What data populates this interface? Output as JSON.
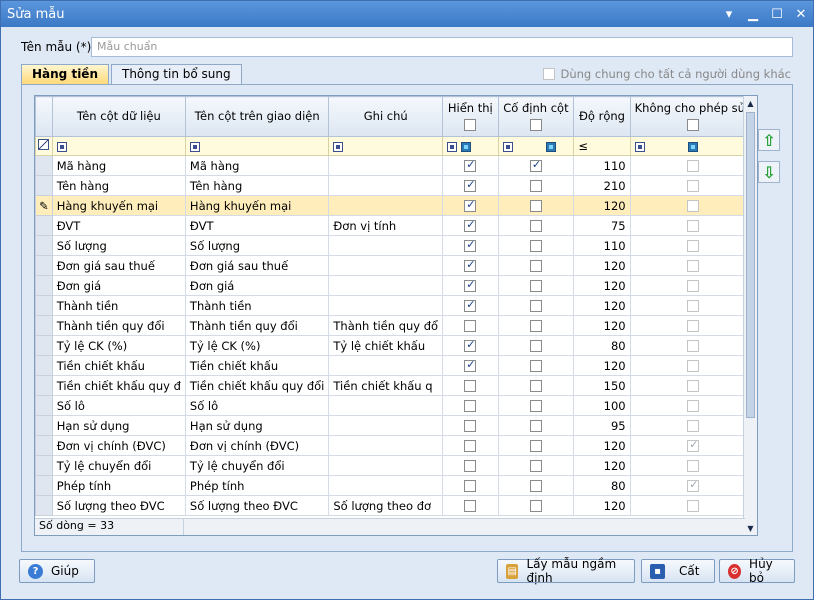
{
  "window": {
    "title": "Sửa mẫu"
  },
  "form": {
    "name_label": "Tên mẫu (*)",
    "name_value": "Mẫu chuẩn"
  },
  "tabs": [
    {
      "label": "Hàng tiền"
    },
    {
      "label": "Thông tin bổ sung"
    }
  ],
  "share_label": "Dùng chung cho tất cả người dùng khác",
  "grid": {
    "headers": {
      "data_col": "Tên cột dữ liệu",
      "ui_col": "Tên cột trên giao diện",
      "note": "Ghi chú",
      "show": "Hiển thị",
      "fixed": "Cố định cột",
      "width": "Độ rộng",
      "no_edit": "Không cho phép sửa"
    },
    "width_filter_op": "≤",
    "rows": [
      {
        "data": "Mã hàng",
        "ui": "Mã hàng",
        "note": "",
        "show": true,
        "fixed": true,
        "width": "110",
        "no_edit": false
      },
      {
        "data": "Tên hàng",
        "ui": "Tên hàng",
        "note": "",
        "show": true,
        "fixed": false,
        "width": "210",
        "no_edit": false
      },
      {
        "data": "Hàng khuyến mại",
        "ui": "Hàng khuyến mại",
        "note": "",
        "show": true,
        "fixed": false,
        "width": "120",
        "no_edit": false
      },
      {
        "data": "ĐVT",
        "ui": "ĐVT",
        "note": "Đơn vị tính",
        "show": true,
        "fixed": false,
        "width": "75",
        "no_edit": false
      },
      {
        "data": "Số lượng",
        "ui": "Số lượng",
        "note": "",
        "show": true,
        "fixed": false,
        "width": "110",
        "no_edit": false
      },
      {
        "data": "Đơn giá sau thuế",
        "ui": "Đơn giá sau thuế",
        "note": "",
        "show": true,
        "fixed": false,
        "width": "120",
        "no_edit": false
      },
      {
        "data": "Đơn giá",
        "ui": "Đơn giá",
        "note": "",
        "show": true,
        "fixed": false,
        "width": "120",
        "no_edit": false
      },
      {
        "data": "Thành tiền",
        "ui": "Thành tiền",
        "note": "",
        "show": true,
        "fixed": false,
        "width": "120",
        "no_edit": false
      },
      {
        "data": "Thành tiền quy đổi",
        "ui": "Thành tiền quy đổi",
        "note": "Thành tiền quy đổ",
        "show": false,
        "fixed": false,
        "width": "120",
        "no_edit": false
      },
      {
        "data": "Tỷ lệ CK (%)",
        "ui": "Tỷ lệ CK (%)",
        "note": "Tỷ lệ chiết khấu",
        "show": true,
        "fixed": false,
        "width": "80",
        "no_edit": false
      },
      {
        "data": "Tiền chiết khấu",
        "ui": "Tiền chiết khấu",
        "note": "",
        "show": true,
        "fixed": false,
        "width": "120",
        "no_edit": false
      },
      {
        "data": "Tiền chiết khấu quy đ",
        "ui": "Tiền chiết khấu quy đổi",
        "note": "Tiền chiết khấu q",
        "show": false,
        "fixed": false,
        "width": "150",
        "no_edit": false
      },
      {
        "data": "Số lô",
        "ui": "Số lô",
        "note": "",
        "show": false,
        "fixed": false,
        "width": "100",
        "no_edit": false
      },
      {
        "data": "Hạn sử dụng",
        "ui": "Hạn sử dụng",
        "note": "",
        "show": false,
        "fixed": false,
        "width": "95",
        "no_edit": false
      },
      {
        "data": "Đơn vị chính (ĐVC)",
        "ui": "Đơn vị chính (ĐVC)",
        "note": "",
        "show": false,
        "fixed": false,
        "width": "120",
        "no_edit": true
      },
      {
        "data": "Tỷ lệ chuyển đổi",
        "ui": "Tỷ lệ chuyển đổi",
        "note": "",
        "show": false,
        "fixed": false,
        "width": "120",
        "no_edit": false
      },
      {
        "data": "Phép tính",
        "ui": "Phép tính",
        "note": "",
        "show": false,
        "fixed": false,
        "width": "80",
        "no_edit": true
      },
      {
        "data": "Số lượng theo ĐVC",
        "ui": "Số lượng theo ĐVC",
        "note": "Số lượng theo đơ",
        "show": false,
        "fixed": false,
        "width": "120",
        "no_edit": false
      }
    ],
    "selected_row": 2,
    "footer": "Số dòng = 33"
  },
  "buttons": {
    "help": "Giúp",
    "default": "Lấy mẫu ngầm định",
    "save": "Cất",
    "cancel": "Hủy bỏ"
  }
}
